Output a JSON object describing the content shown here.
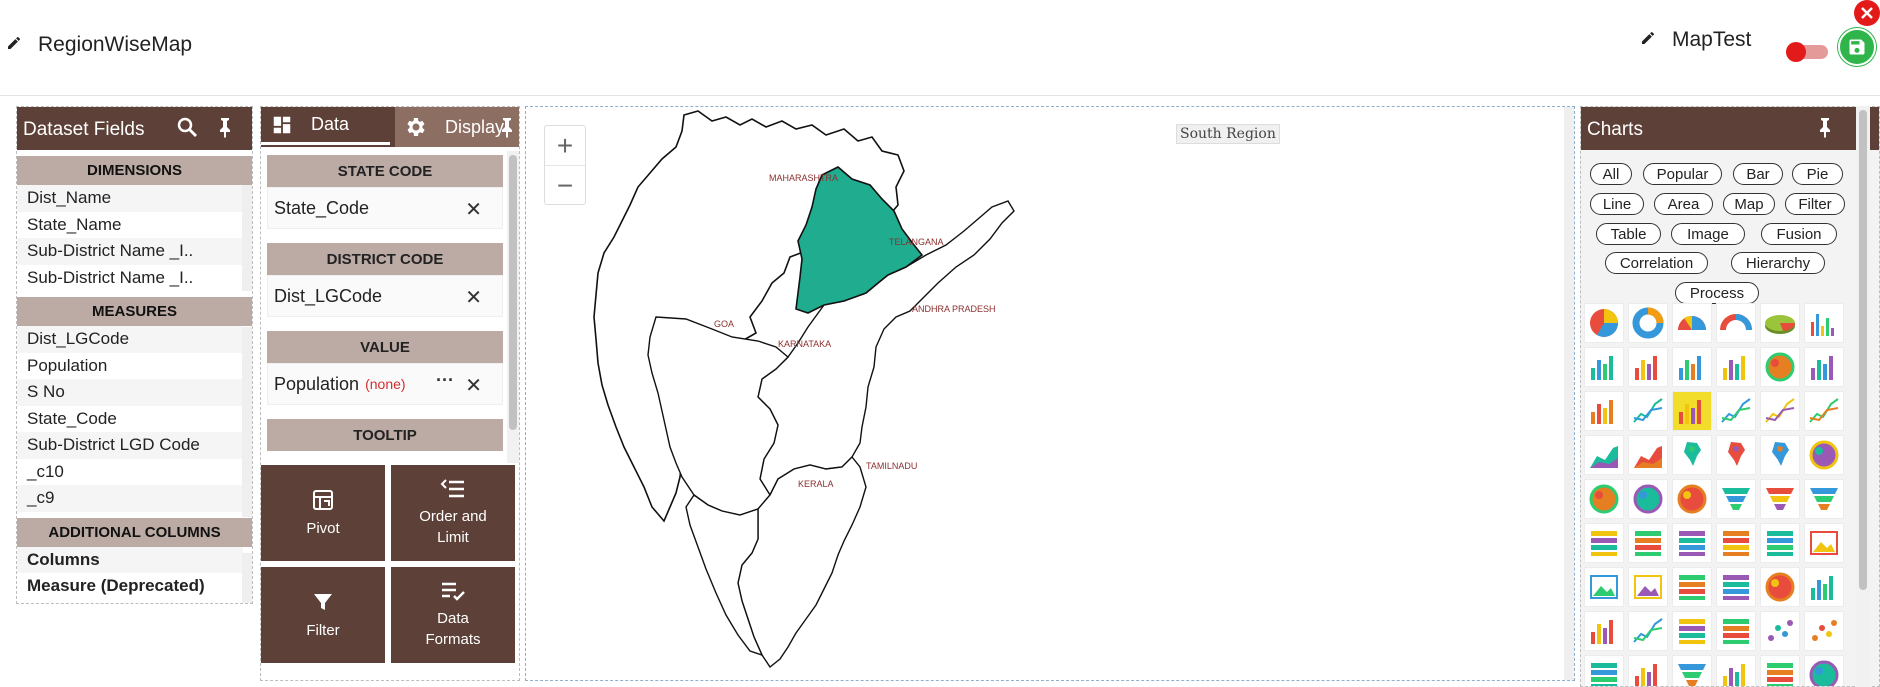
{
  "header": {
    "report_title": "RegionWiseMap",
    "dashboard_title": "MapTest"
  },
  "dataset_fields": {
    "title": "Dataset Fields",
    "dimensions_header": "DIMENSIONS",
    "dimensions": [
      "Dist_Name",
      "State_Name",
      "Sub-District Name _I..",
      "Sub-District Name _I.."
    ],
    "measures_header": "MEASURES",
    "measures": [
      "Dist_LGCode",
      "Population",
      "S No",
      "State_Code",
      "Sub-District LGD Code",
      "_c10",
      "_c9"
    ],
    "additional_header": "ADDITIONAL COLUMNS",
    "additional": [
      "Columns",
      "Measure (Deprecated)"
    ]
  },
  "data_panel": {
    "tab_data": "Data",
    "tab_display": "Display",
    "slots": [
      {
        "header": "STATE CODE",
        "value": "State_Code",
        "note": ""
      },
      {
        "header": "DISTRICT CODE",
        "value": "Dist_LGCode",
        "note": ""
      },
      {
        "header": "VALUE",
        "value": "Population",
        "note": "(none)"
      },
      {
        "header": "TOOLTIP",
        "value": "",
        "note": ""
      }
    ],
    "actions": {
      "pivot": "Pivot",
      "order_limit": "Order and Limit",
      "filter": "Filter",
      "data_formats": "Data Formats"
    }
  },
  "map": {
    "title": "South Region",
    "zoom_in": "+",
    "zoom_out": "−",
    "regions": {
      "maharashtra": "MAHARASHTRA",
      "telangana": "TELANGANA",
      "andhra": "ANDHRA PRADESH",
      "karnataka": "KARNATAKA",
      "tamilnadu": "TAMILNADU",
      "kerala": "KERALA",
      "goa": "GOA"
    },
    "highlight_color": "#20ad8f"
  },
  "charts": {
    "title": "Charts",
    "categories": [
      "All",
      "Popular",
      "Bar",
      "Pie",
      "Line",
      "Area",
      "Map",
      "Filter",
      "Table",
      "Image",
      "Fusion",
      "Correlation",
      "Hierarchy",
      "Process"
    ],
    "selected_icon_index": 14
  },
  "colors": {
    "panel_brown": "#5d4037",
    "section_tan": "#bcaaa4",
    "save_green": "#2fb54a",
    "close_red": "#e31a1a"
  }
}
